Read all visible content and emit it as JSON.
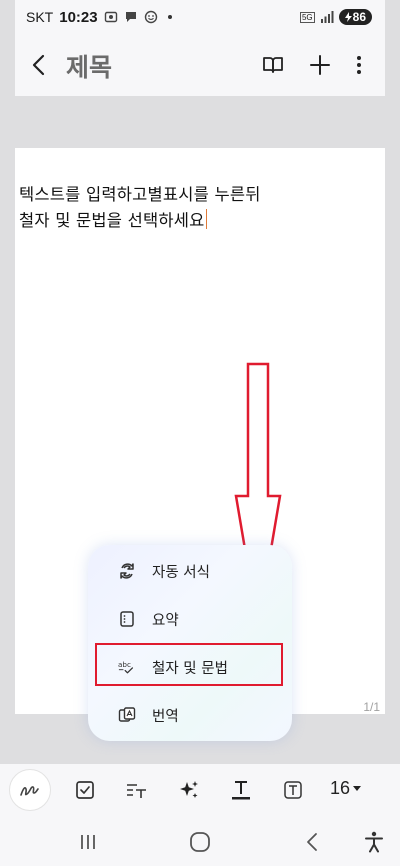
{
  "status": {
    "carrier": "SKT",
    "time": "10:23",
    "network": "5G",
    "battery": "86",
    "icons": [
      "screenshot-icon",
      "chat-icon",
      "emoji-icon",
      "notification-dot",
      "signal-icon",
      "battery-icon"
    ]
  },
  "app_bar": {
    "title": "제목",
    "back_icon": "chevron-left-icon",
    "actions": [
      "book-icon",
      "plus-icon",
      "more-vert-icon"
    ]
  },
  "note": {
    "lines": [
      "텍스트를 입력하고별표시를 누른뒤",
      "철자 및 문법을 선택하세요"
    ],
    "page_indicator": "1/1"
  },
  "popup_menu": {
    "items": [
      {
        "label": "자동 서식",
        "icon": "auto-format-icon"
      },
      {
        "label": "요약",
        "icon": "summary-icon"
      },
      {
        "label": "철자 및 문법",
        "icon": "spell-check-icon"
      },
      {
        "label": "번역",
        "icon": "translate-icon"
      }
    ],
    "highlighted_item": "철자 및 문법"
  },
  "annotation": {
    "arrow_color": "#e01b2f",
    "highlight_color": "#e01b2f"
  },
  "toolbar": {
    "items": [
      "handwriting-pen-icon",
      "checkbox-icon",
      "text-style-icon",
      "ai-sparkle-icon",
      "text-color-icon",
      "text-box-icon"
    ],
    "font_size": "16"
  },
  "nav_bar": {
    "items": [
      "recent-apps-icon",
      "home-icon",
      "back-icon",
      "accessibility-icon"
    ]
  }
}
